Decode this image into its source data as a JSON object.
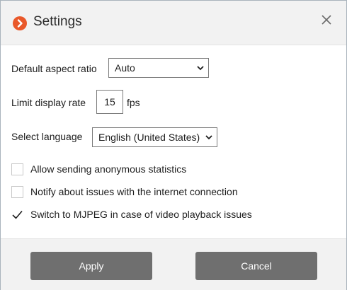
{
  "dialog": {
    "title": "Settings",
    "logo_icon": "chevron-right-icon",
    "close_icon": "close-icon",
    "accent_color": "#e9582a"
  },
  "settings": {
    "aspect_ratio": {
      "label": "Default aspect ratio",
      "value": "Auto"
    },
    "display_rate": {
      "label": "Limit display rate",
      "value": "15",
      "unit": "fps"
    },
    "language": {
      "label": "Select language",
      "value": "English (United States)"
    }
  },
  "options": [
    {
      "label": "Allow sending anonymous statistics",
      "checked": false
    },
    {
      "label": "Notify about issues with the internet connection",
      "checked": false
    },
    {
      "label": "Switch to MJPEG in case of video playback issues",
      "checked": true
    }
  ],
  "footer": {
    "apply_label": "Apply",
    "cancel_label": "Cancel"
  }
}
